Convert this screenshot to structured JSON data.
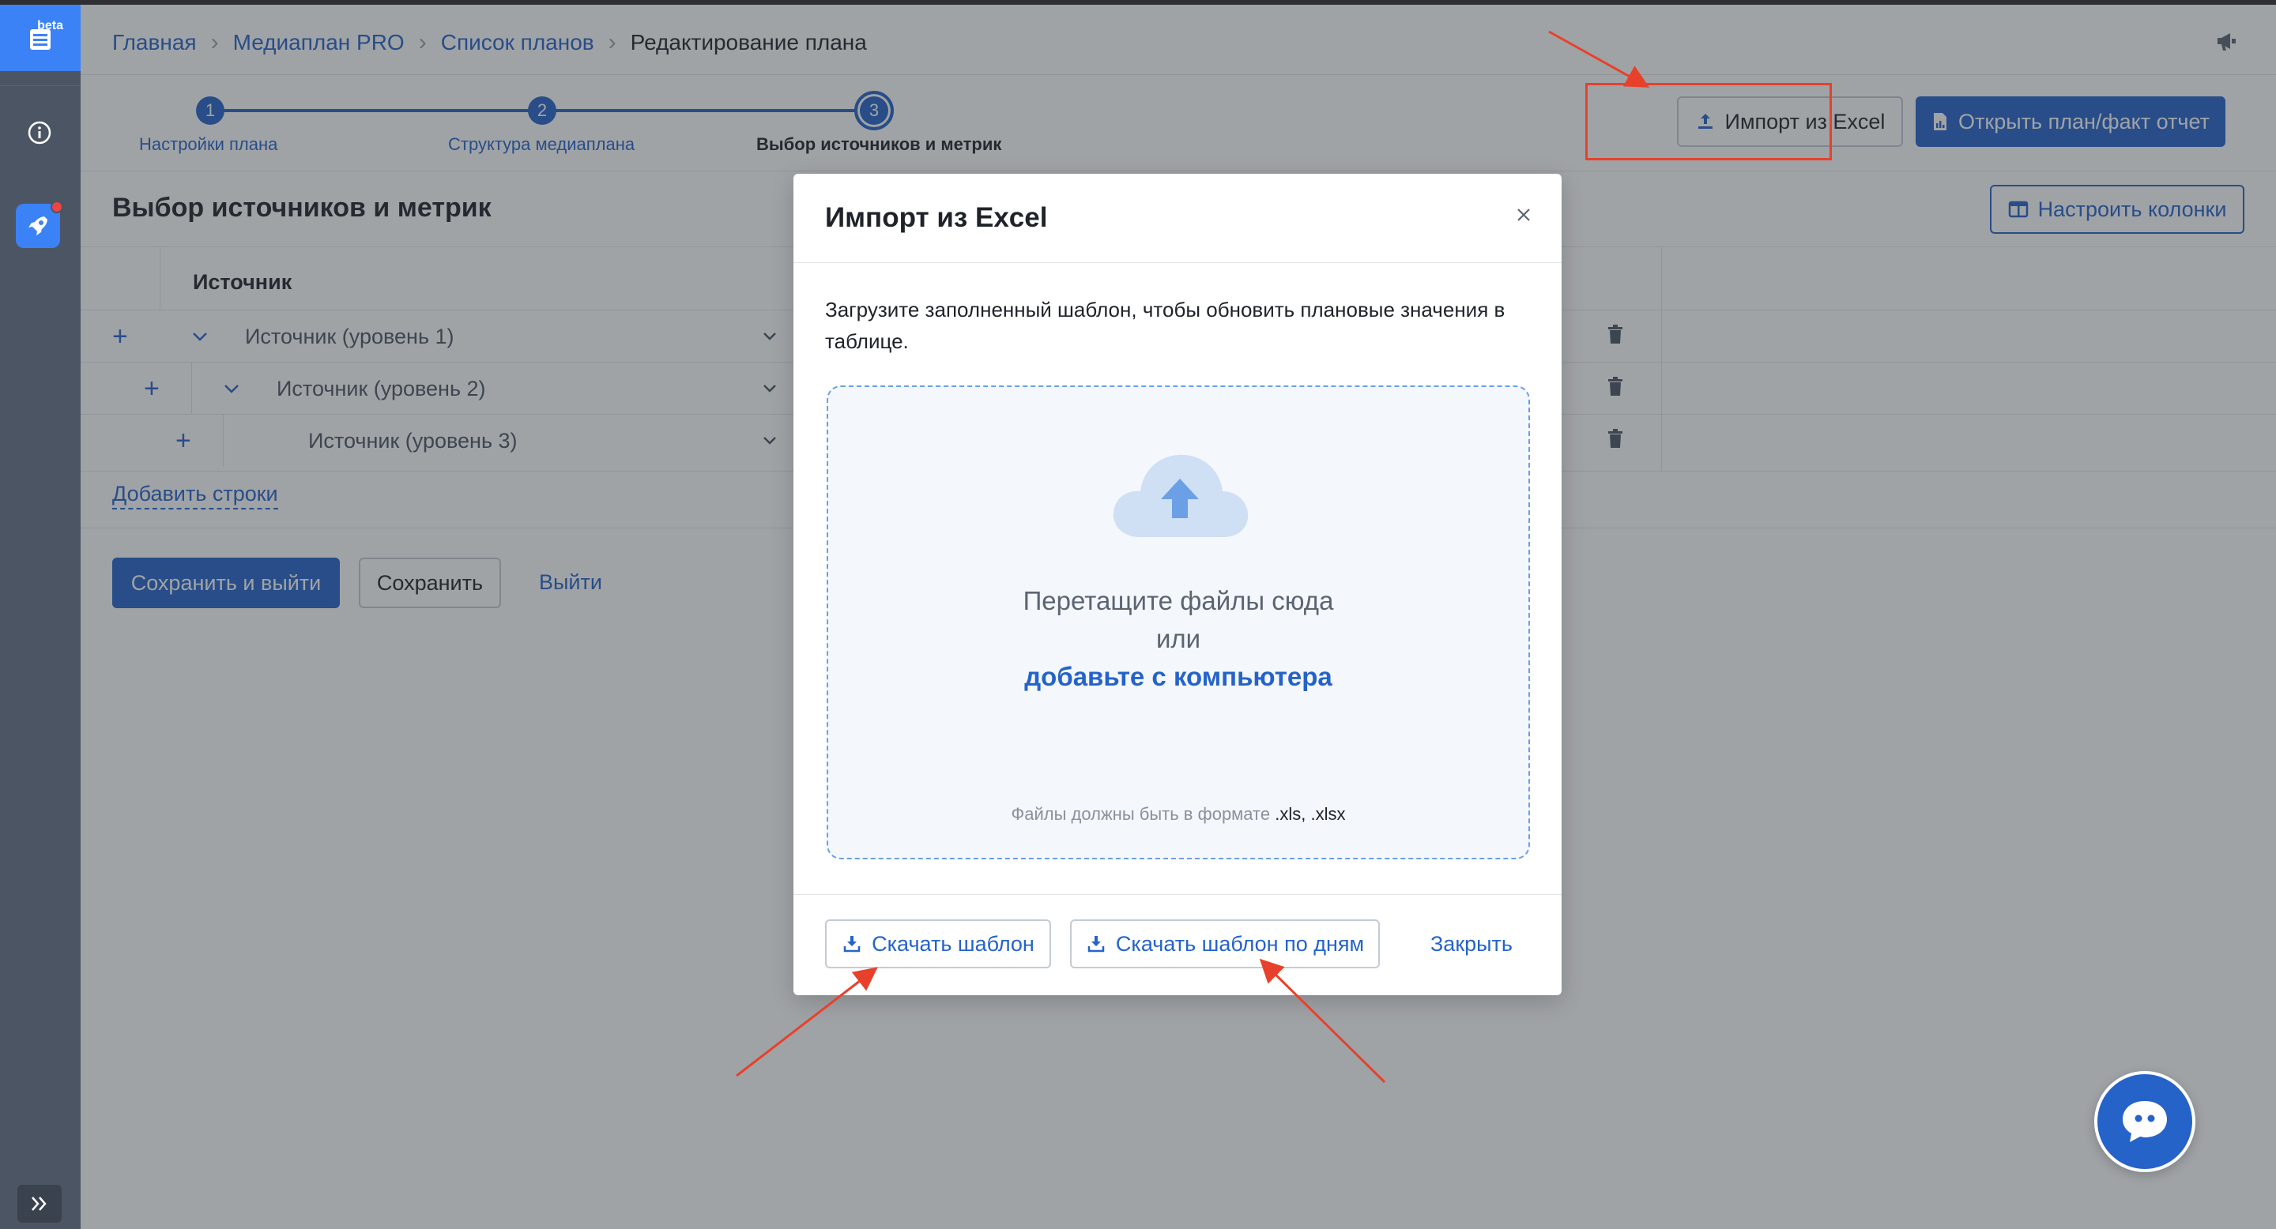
{
  "sidebar": {
    "badge": "beta"
  },
  "breadcrumbs": [
    "Главная",
    "Медиаплан PRO",
    "Список планов",
    "Редактирование плана"
  ],
  "stepper": {
    "steps": [
      {
        "number": "1",
        "label": "Настройки плана"
      },
      {
        "number": "2",
        "label": "Структура медиаплана"
      },
      {
        "number": "3",
        "label": "Выбор источников и метрик"
      }
    ],
    "active_step": 3
  },
  "toolbar": {
    "import_label": "Импорт из Excel",
    "report_label": "Открыть план/факт отчет",
    "columns_label": "Настроить колонки"
  },
  "section_title": "Выбор источников и метрик",
  "table": {
    "header_source": "Источник",
    "rows": [
      {
        "level": 1,
        "label": "Источник (уровень 1)"
      },
      {
        "level": 2,
        "label": "Источник (уровень 2)"
      },
      {
        "level": 3,
        "label": "Источник (уровень 3)"
      }
    ],
    "add_rows_label": "Добавить строки"
  },
  "actions": {
    "save_exit_label": "Сохранить и выйти",
    "save_label": "Сохранить",
    "exit_label": "Выйти"
  },
  "modal": {
    "title": "Импорт из Excel",
    "description": "Загрузите заполненный шаблон, чтобы обновить плановые значения в таблице.",
    "dropzone": {
      "line1": "Перетащите файлы сюда",
      "line2": "или",
      "link": "добавьте с компьютера",
      "hint_prefix": "Файлы должны быть в формате ",
      "hint_ext": ".xls, .xlsx"
    },
    "download_template_label": "Скачать шаблон",
    "download_daily_template_label": "Скачать шаблон по дням",
    "close_label": "Закрыть"
  },
  "colors": {
    "primary": "#2563c9",
    "sidebar": "#4b5563",
    "annotation_red": "#e8412b"
  },
  "icons": [
    "beta-table-icon",
    "info-icon",
    "rocket-icon",
    "expand-icon",
    "megaphone-icon",
    "upload-icon",
    "report-icon",
    "columns-icon",
    "trash-icon",
    "close-icon",
    "cloud-upload-icon",
    "download-icon",
    "chat-icon"
  ]
}
